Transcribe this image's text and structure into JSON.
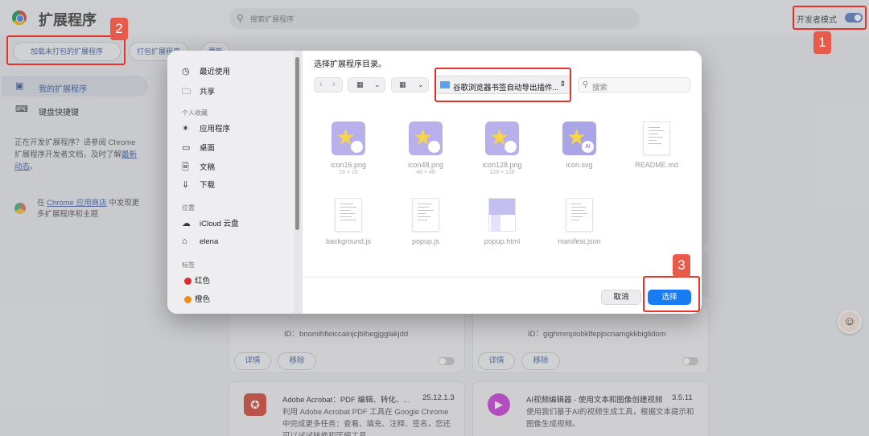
{
  "header": {
    "title": "扩展程序",
    "search_placeholder": "搜索扩展程序",
    "dev_mode_label": "开发者模式"
  },
  "toolbar": {
    "load_unpacked": "加载未打包的扩展程序",
    "pack": "打包扩展程序",
    "update": "更新"
  },
  "sidebar": {
    "items": [
      {
        "label": "我的扩展程序",
        "icon": "puzzle-icon"
      },
      {
        "label": "键盘快捷键",
        "icon": "keyboard-icon"
      }
    ],
    "dev_text_prefix": "正在开发扩展程序？请参阅 Chrome 扩展程序开发者文档，及时了解",
    "dev_text_link": "最新动态",
    "dev_text_suffix": "。",
    "store_prefix": "在 ",
    "store_link": "Chrome 应用商店",
    "store_suffix": " 中发现更多扩展程序和主题"
  },
  "cards": {
    "c1": {
      "id_text": "ID：bnomihfieiccainjcjblhegjgglakjdd",
      "detail": "详情",
      "remove": "移除"
    },
    "c2": {
      "id_text": "ID：gighmmpiobklfepjocnamgkkbiglidom",
      "detail": "详情",
      "remove": "移除"
    },
    "c3": {
      "name": "Adobe Acrobat：PDF 编辑、转化、...",
      "version": "25.12.1.3",
      "desc": "利用 Adobe Acrobat PDF 工具在 Google Chrome 中完成更多任务：查看、填充、注释、签名，您还可以试试转换和压缩工具。"
    },
    "c4": {
      "name": "AI视频编辑器 - 使用文本和图像创建视频",
      "version": "3.5.11",
      "desc": "使用我们基于AI的视频生成工具，根据文本提示和图像生成视频。"
    }
  },
  "dialog": {
    "prompt": "选择扩展程序目录。",
    "path": "谷歌浏览器书签自动导出插件...",
    "search_placeholder": "搜索",
    "sidebar": {
      "recent": "最近使用",
      "shared": "共享",
      "favorites_heading": "个人收藏",
      "apps": "应用程序",
      "desktop": "桌面",
      "documents": "文稿",
      "downloads": "下载",
      "locations_heading": "位置",
      "icloud": "iCloud 云盘",
      "home": "elena",
      "tags_heading": "标签",
      "tag_red": "红色",
      "tag_orange": "橙色"
    },
    "files": [
      {
        "name": "icon16.png",
        "dim": "16 × 16",
        "type": "png"
      },
      {
        "name": "icon48.png",
        "dim": "48 × 48",
        "type": "png"
      },
      {
        "name": "icon128.png",
        "dim": "128 × 128",
        "type": "png"
      },
      {
        "name": "icon.svg",
        "dim": "",
        "type": "svg"
      },
      {
        "name": "README.md",
        "dim": "",
        "type": "doc"
      },
      {
        "name": "background.js",
        "dim": "",
        "type": "doc"
      },
      {
        "name": "popup.js",
        "dim": "",
        "type": "doc"
      },
      {
        "name": "popup.html",
        "dim": "",
        "type": "html"
      },
      {
        "name": "manifest.json",
        "dim": "",
        "type": "doc"
      }
    ],
    "cancel": "取消",
    "choose": "选择"
  },
  "annotations": {
    "n1": "1",
    "n2": "2",
    "n3": "3"
  },
  "colors": {
    "accent": "#1a7cf3",
    "annotation": "#e63329",
    "link": "#3d5fa8"
  }
}
